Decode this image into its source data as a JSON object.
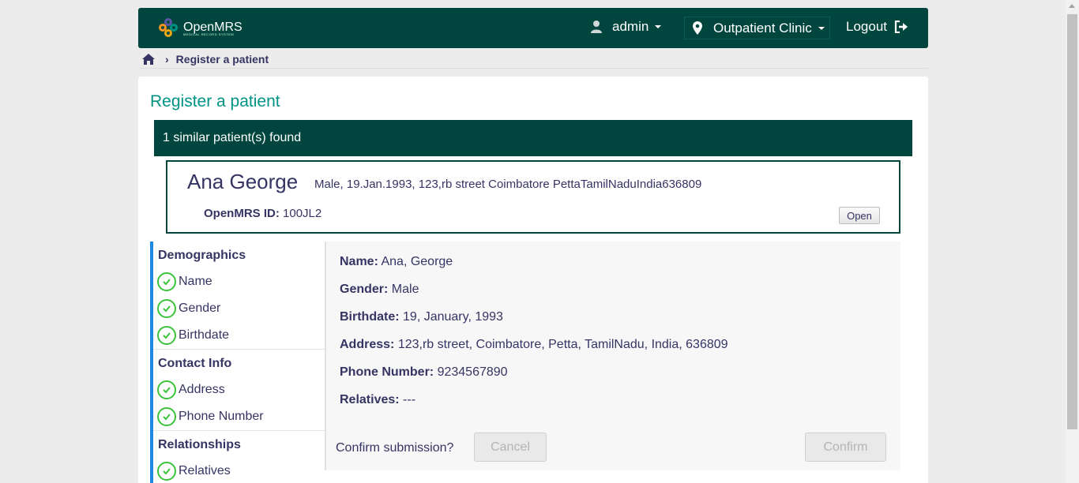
{
  "header": {
    "logo_text": "OpenMRS",
    "logo_subtext": "MEDICAL RECORD SYSTEM",
    "user": "admin",
    "location": "Outpatient Clinic",
    "logout": "Logout"
  },
  "breadcrumb": {
    "current": "Register a patient"
  },
  "page": {
    "title": "Register a patient",
    "similar_found": "1 similar patient(s) found"
  },
  "match": {
    "name": "Ana George",
    "details": "Male, 19.Jan.1993, 123,rb street Coimbatore PettaTamilNaduIndia636809",
    "id_label": "OpenMRS ID:",
    "id_value": "100JL2",
    "open_label": "Open"
  },
  "sidenav": {
    "sections": [
      {
        "title": "Demographics",
        "items": [
          "Name",
          "Gender",
          "Birthdate"
        ]
      },
      {
        "title": "Contact Info",
        "items": [
          "Address",
          "Phone Number"
        ]
      },
      {
        "title": "Relationships",
        "items": [
          "Relatives"
        ]
      }
    ]
  },
  "summary": {
    "name_label": "Name:",
    "name_value": "Ana, George",
    "gender_label": "Gender:",
    "gender_value": "Male",
    "birthdate_label": "Birthdate:",
    "birthdate_value": "19, January, 1993",
    "address_label": "Address:",
    "address_value": "123,rb street, Coimbatore, Petta, TamilNadu, India, 636809",
    "phone_label": "Phone Number:",
    "phone_value": "9234567890",
    "relatives_label": "Relatives:",
    "relatives_value": "---",
    "confirm_question": "Confirm submission?",
    "cancel_label": "Cancel",
    "confirm_label": "Confirm"
  },
  "colors": {
    "header_bg": "#00463f",
    "accent_teal": "#009384",
    "nav_border": "#1e88e5",
    "check_green": "#3bc33b"
  },
  "icons": [
    "home-icon",
    "user-icon",
    "map-marker-icon",
    "logout-icon",
    "check-circle-icon",
    "chevron-right-icon"
  ]
}
